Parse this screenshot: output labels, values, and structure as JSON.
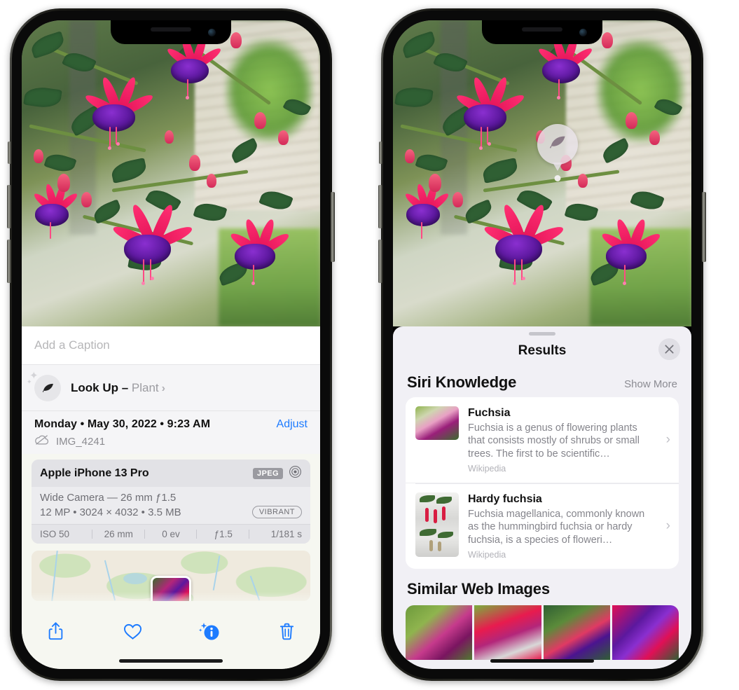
{
  "left_phone": {
    "caption": {
      "placeholder": "Add a Caption",
      "value": ""
    },
    "look_up": {
      "label": "Look Up",
      "dash": " – ",
      "subject": "Plant",
      "chevron": "›",
      "icon": "leaf-icon",
      "sparkle": "✦"
    },
    "metadata": {
      "date_line": "Monday • May 30, 2022 • 9:23 AM",
      "adjust_label": "Adjust",
      "filename": "IMG_4241",
      "cloud_icon": "cloud-slash-icon"
    },
    "camera_card": {
      "model": "Apple iPhone 13 Pro",
      "format_tag": "JPEG",
      "aperture_icon": "aperture-icon",
      "lens_line": "Wide Camera — 26 mm ƒ1.5",
      "spec_line": "12 MP • 3024 × 4032 • 3.5 MB",
      "style_tag": "VIBRANT",
      "exif": [
        "ISO 50",
        "26 mm",
        "0 ev",
        "ƒ1.5",
        "1/181 s"
      ]
    },
    "map": {
      "pin_label": "photo-thumbnail-pin"
    },
    "toolbar": {
      "share_label": "share-icon",
      "favorite_label": "heart-icon",
      "info_label": "info-sparkle-icon",
      "delete_label": "trash-icon"
    }
  },
  "right_phone": {
    "visual_lookup_badge": {
      "icon": "leaf-icon"
    },
    "sheet": {
      "title": "Results",
      "close_label": "✕"
    },
    "siri_knowledge": {
      "section_title": "Siri Knowledge",
      "show_more": "Show More",
      "items": [
        {
          "title": "Fuchsia",
          "description": "Fuchsia is a genus of flowering plants that consists mostly of shrubs or small trees. The first to be scientific…",
          "source": "Wikipedia",
          "chevron": "›"
        },
        {
          "title": "Hardy fuchsia",
          "description": "Fuchsia magellanica, commonly known as the hummingbird fuchsia or hardy fuchsia, is a species of floweri…",
          "source": "Wikipedia",
          "chevron": "›"
        }
      ]
    },
    "similar_web_images": {
      "section_title": "Similar Web Images",
      "thumbnails": [
        "web-image-1",
        "web-image-2",
        "web-image-3",
        "web-image-4"
      ]
    }
  },
  "colors": {
    "accent_blue": "#1d7bff",
    "sheet_bg": "#f1f0f5",
    "card_bg": "#ffffff",
    "muted_text": "#85858c"
  }
}
